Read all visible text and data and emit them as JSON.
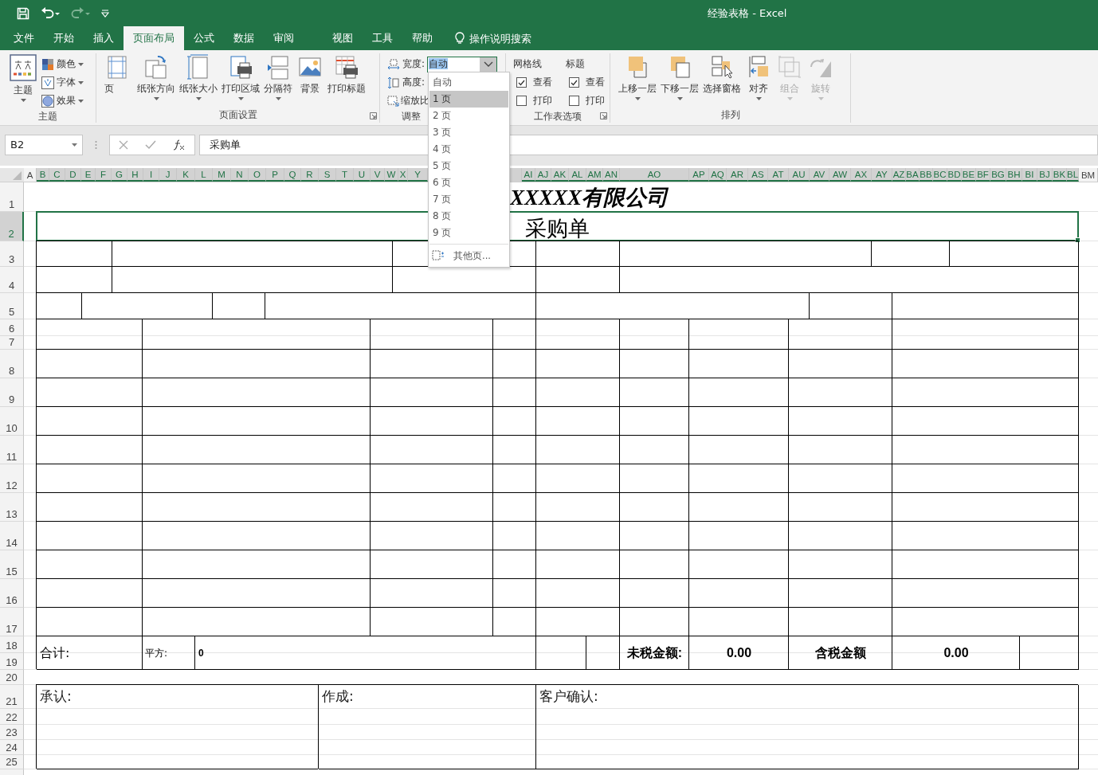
{
  "title_bar": {
    "title": "经验表格  -  Excel"
  },
  "tabs": [
    {
      "label": "文件",
      "selected": false
    },
    {
      "label": "开始",
      "selected": false
    },
    {
      "label": "插入",
      "selected": false
    },
    {
      "label": "页面布局",
      "selected": true
    },
    {
      "label": "公式",
      "selected": false
    },
    {
      "label": "数据",
      "selected": false
    },
    {
      "label": "审阅",
      "selected": false
    },
    {
      "label": "视图",
      "selected": false
    },
    {
      "label": "工具",
      "selected": false
    },
    {
      "label": "帮助",
      "selected": false
    }
  ],
  "tell_me": {
    "placeholder": "操作说明搜索"
  },
  "ribbon": {
    "theme": {
      "label": "主题",
      "button": "主题",
      "items": [
        "颜色",
        "字体",
        "效果"
      ]
    },
    "page_setup": {
      "label": "页面设置",
      "buttons": [
        {
          "label": "页",
          "dropdown": false
        },
        {
          "label": "纸张方向",
          "dropdown": true
        },
        {
          "label": "纸张大小",
          "dropdown": true
        },
        {
          "label": "打印区域",
          "dropdown": true
        },
        {
          "label": "分隔符",
          "dropdown": true
        },
        {
          "label": "背景",
          "dropdown": false
        },
        {
          "label": "打印标题",
          "dropdown": false
        }
      ]
    },
    "scale": {
      "label": "调整",
      "width_label": "宽度:",
      "width_value": "自动",
      "height_label": "高度:",
      "scale_label": "缩放比"
    },
    "sheet_options": {
      "label": "工作表选项",
      "columns": [
        {
          "heading": "网格线",
          "options": [
            {
              "label": "查看",
              "checked": true
            },
            {
              "label": "打印",
              "checked": false
            }
          ]
        },
        {
          "heading": "标题",
          "options": [
            {
              "label": "查看",
              "checked": true
            },
            {
              "label": "打印",
              "checked": false
            }
          ]
        }
      ]
    },
    "arrange": {
      "label": "排列",
      "buttons": [
        {
          "label": "上移一层",
          "dropdown": true,
          "disabled": false
        },
        {
          "label": "下移一层",
          "dropdown": true,
          "disabled": false
        },
        {
          "label": "选择窗格",
          "dropdown": false,
          "disabled": false
        },
        {
          "label": "对齐",
          "dropdown": true,
          "disabled": false
        },
        {
          "label": "组合",
          "dropdown": true,
          "disabled": true
        },
        {
          "label": "旋转",
          "dropdown": true,
          "disabled": true
        }
      ]
    }
  },
  "formula_bar": {
    "name_box": "B2",
    "formula": "采购单"
  },
  "column_headers": [
    {
      "label": "A",
      "selected": false
    },
    {
      "label": "B",
      "selected": true
    },
    {
      "label": "C",
      "selected": true
    },
    {
      "label": "D",
      "selected": true
    },
    {
      "label": "E",
      "selected": true
    },
    {
      "label": "F",
      "selected": true
    },
    {
      "label": "G",
      "selected": true
    },
    {
      "label": "H",
      "selected": true
    },
    {
      "label": "I",
      "selected": true
    },
    {
      "label": "J",
      "selected": true
    },
    {
      "label": "K",
      "selected": true
    },
    {
      "label": "L",
      "selected": true
    },
    {
      "label": "M",
      "selected": true
    },
    {
      "label": "N",
      "selected": true
    },
    {
      "label": "O",
      "selected": true
    },
    {
      "label": "P",
      "selected": true
    },
    {
      "label": "Q",
      "selected": true
    },
    {
      "label": "R",
      "selected": true
    },
    {
      "label": "S",
      "selected": true
    },
    {
      "label": "T",
      "selected": true
    },
    {
      "label": "U",
      "selected": true
    },
    {
      "label": "V",
      "selected": true
    },
    {
      "label": "W",
      "selected": true
    },
    {
      "label": "X",
      "selected": true
    },
    {
      "label": "Y",
      "selected": true
    },
    {
      "label": "AI",
      "selected": true
    },
    {
      "label": "AJ",
      "selected": true
    },
    {
      "label": "AK",
      "selected": true
    },
    {
      "label": "AL",
      "selected": true
    },
    {
      "label": "AM",
      "selected": true
    },
    {
      "label": "AN",
      "selected": true
    },
    {
      "label": "AO",
      "selected": true
    },
    {
      "label": "AP",
      "selected": true
    },
    {
      "label": "AQ",
      "selected": true
    },
    {
      "label": "AR",
      "selected": true
    },
    {
      "label": "AS",
      "selected": true
    },
    {
      "label": "AT",
      "selected": true
    },
    {
      "label": "AU",
      "selected": true
    },
    {
      "label": "AV",
      "selected": true
    },
    {
      "label": "AW",
      "selected": true
    },
    {
      "label": "AX",
      "selected": true
    },
    {
      "label": "AY",
      "selected": true
    },
    {
      "label": "AZ",
      "selected": true
    },
    {
      "label": "BA",
      "selected": true
    },
    {
      "label": "BB",
      "selected": true
    },
    {
      "label": "BC",
      "selected": true
    },
    {
      "label": "BD",
      "selected": true
    },
    {
      "label": "BE",
      "selected": true
    },
    {
      "label": "BF",
      "selected": true
    },
    {
      "label": "BG",
      "selected": true
    },
    {
      "label": "BH",
      "selected": true
    },
    {
      "label": "BI",
      "selected": true
    },
    {
      "label": "BJ",
      "selected": true
    },
    {
      "label": "BK",
      "selected": true
    },
    {
      "label": "BL",
      "selected": true
    },
    {
      "label": "BM",
      "selected": false
    }
  ],
  "row_headers": [
    {
      "label": "1",
      "selected": false
    },
    {
      "label": "2",
      "selected": true
    },
    {
      "label": "3",
      "selected": false
    },
    {
      "label": "4",
      "selected": false
    },
    {
      "label": "5",
      "selected": false
    },
    {
      "label": "6",
      "selected": false
    },
    {
      "label": "7",
      "selected": false
    },
    {
      "label": "8",
      "selected": false
    },
    {
      "label": "9",
      "selected": false
    },
    {
      "label": "10",
      "selected": false
    },
    {
      "label": "11",
      "selected": false
    },
    {
      "label": "12",
      "selected": false
    },
    {
      "label": "13",
      "selected": false
    },
    {
      "label": "14",
      "selected": false
    },
    {
      "label": "15",
      "selected": false
    },
    {
      "label": "16",
      "selected": false
    },
    {
      "label": "17",
      "selected": false
    },
    {
      "label": "18",
      "selected": false
    },
    {
      "label": "19",
      "selected": false
    },
    {
      "label": "20",
      "selected": false
    },
    {
      "label": "21",
      "selected": false
    },
    {
      "label": "22",
      "selected": false
    },
    {
      "label": "23",
      "selected": false
    },
    {
      "label": "24",
      "selected": false
    },
    {
      "label": "25",
      "selected": false
    }
  ],
  "sheet": {
    "company": "XXXXX有限公司",
    "title": "采购单",
    "totals": [
      "合计:",
      "平方:",
      "0",
      "未税金额:",
      "0.00",
      "含税金额",
      "0.00"
    ],
    "signatures": [
      "承认:",
      "作成:",
      "客户确认:"
    ]
  },
  "width_menu": {
    "items": [
      {
        "label": "自动",
        "selected": false
      },
      {
        "label": "1 页",
        "selected": true
      },
      {
        "label": "2 页",
        "selected": false
      },
      {
        "label": "3 页",
        "selected": false
      },
      {
        "label": "4 页",
        "selected": false
      },
      {
        "label": "5 页",
        "selected": false
      },
      {
        "label": "6 页",
        "selected": false
      },
      {
        "label": "7 页",
        "selected": false
      },
      {
        "label": "8 页",
        "selected": false
      },
      {
        "label": "9 页",
        "selected": false
      }
    ],
    "more": "其他页..."
  }
}
